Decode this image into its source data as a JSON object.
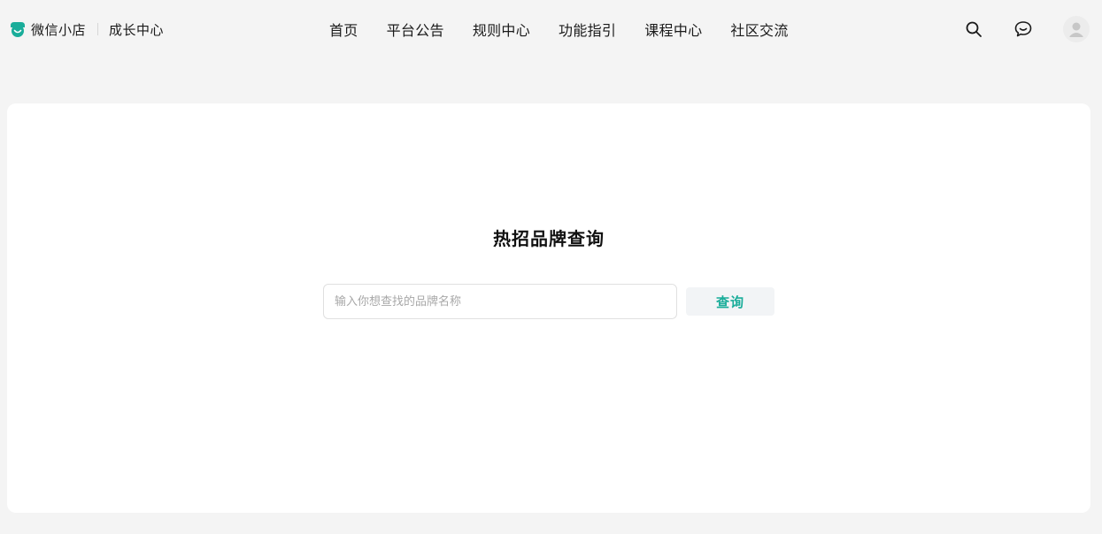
{
  "header": {
    "brand_name": "微信小店",
    "brand_sub": "成长中心",
    "nav": [
      {
        "label": "首页"
      },
      {
        "label": "平台公告"
      },
      {
        "label": "规则中心"
      },
      {
        "label": "功能指引"
      },
      {
        "label": "课程中心"
      },
      {
        "label": "社区交流"
      }
    ],
    "icons": {
      "logo": "wechat-shop-logo",
      "search": "search-icon",
      "chat": "chat-bubble-icon",
      "avatar": "user-avatar-icon"
    }
  },
  "main": {
    "title": "热招品牌查询",
    "search": {
      "value": "",
      "placeholder": "输入你想查找的品牌名称",
      "button_label": "查询"
    }
  },
  "colors": {
    "accent": "#1aad9a",
    "page_background": "#f4f4f4",
    "card_background": "#ffffff"
  }
}
